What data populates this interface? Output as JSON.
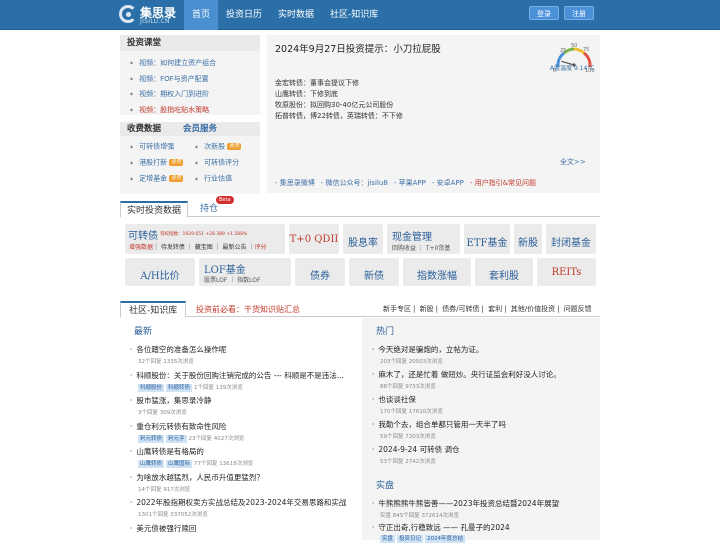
{
  "header": {
    "logo_name": "集思录",
    "logo_sub": "JISILU.CN",
    "nav": [
      "首页",
      "投资日历",
      "实时数据",
      "社区-知识库"
    ],
    "login": "登录",
    "register": "注册"
  },
  "course": {
    "title": "投资课堂",
    "items": [
      "视频：如何建立资产组合",
      "视频：FOF与资产配置",
      "视频：期权入门到进阶",
      "视频：股指吃贴水策略"
    ]
  },
  "data_service": {
    "tab1": "收费数据",
    "tab2": "会员服务",
    "items": [
      {
        "label": "可转债增强",
        "tag": ""
      },
      {
        "label": "次新股",
        "tag": "会员"
      },
      {
        "label": "港股打新",
        "tag": "会员"
      },
      {
        "label": "可转债评分",
        "tag": ""
      },
      {
        "label": "定增基金",
        "tag": "会员"
      },
      {
        "label": "行业估值",
        "tag": ""
      }
    ]
  },
  "tip": {
    "title": "2024年9月27日投资提示：小刀拉屁股",
    "lines": [
      "金宏转债：董事会提议下修",
      "山鹰转债：下修到底",
      "牧原股份：拟回购30-40亿元公司股份",
      "拓普转债，博22转债，英瑞转债：不下修"
    ],
    "more": "全文>>",
    "gauge_label": "A股温度 9.14°C",
    "gauge_ticks": [
      "0",
      "25",
      "50",
      "75",
      "100"
    ],
    "gauge_value": 9.14
  },
  "links": [
    "- 集思录微博",
    "- 微信公众号：jisilu8",
    "- 苹果APP",
    "- 安卓APP",
    "- 用户指引&常见问题"
  ],
  "realtime": {
    "tab": "实时投资数据",
    "hold": "持仓",
    "beta": "Beta",
    "kzz_title": "可转债",
    "kzz_index": "等权指数：1929.651 +28.389 +1.588%",
    "kzz_sub1": "增强数据",
    "kzz_sub_rest": "｜ 待发转债 ｜ 藏宝图 ｜ 最新公告 ｜",
    "kzz_sub_last": "评分",
    "tiles": [
      {
        "title": "T+0 QDII",
        "sub": ""
      },
      {
        "title": "股息率",
        "sub": ""
      },
      {
        "title": "现金管理",
        "sub": "回购收益 ｜ T+0货基"
      },
      {
        "title": "ETF基金",
        "sub": ""
      },
      {
        "title": "新股",
        "sub": ""
      },
      {
        "title": "封闭基金",
        "sub": ""
      },
      {
        "title": "A/H比价",
        "sub": ""
      },
      {
        "title": "LOF基金",
        "sub": "股票LOF ｜ 指数LOF"
      },
      {
        "title": "债券",
        "sub": ""
      },
      {
        "title": "新债",
        "sub": ""
      },
      {
        "title": "指数涨幅",
        "sub": ""
      },
      {
        "title": "套利股",
        "sub": ""
      },
      {
        "title": "REITs",
        "sub": ""
      }
    ]
  },
  "community": {
    "tab": "社区-知识库",
    "note": "投资前必看：干货知识贴汇总",
    "nav": [
      "新手专区",
      "新股",
      "债券/可转债",
      "套利",
      "其他/价值投资",
      "问题反馈"
    ],
    "latest_title": "最新",
    "latest": [
      {
        "title": "各位踏空的准备怎么操作呢",
        "tags": [],
        "meta": "32个回复 1335次浏览"
      },
      {
        "title": "科顺股份：关于股份回购注销完成的公告 --- 科顺是不是违法...",
        "tags": [
          "科顺股份",
          "科顺转债"
        ],
        "meta": "1个回复 139次浏览"
      },
      {
        "title": "股市猛涨，集思录冷静",
        "tags": [],
        "meta": "3个回复 309次浏览"
      },
      {
        "title": "重仓利元转债有致命性风险",
        "tags": [
          "利元转债",
          "利元亨"
        ],
        "meta": "23个回复 4027次浏览"
      },
      {
        "title": "山鹰转债是有格局的",
        "tags": [
          "山鹰转债",
          "山鹰国际"
        ],
        "meta": "77个回复 13618次浏览"
      },
      {
        "title": "为啥放水越猛烈，人民币升值更猛烈？",
        "tags": [],
        "meta": "14个回复 917次浏览"
      },
      {
        "title": "2022年股指期权卖方实战总结及2023-2024年交易思路和实战",
        "tags": [],
        "meta": "1301个回复 337052次浏览"
      },
      {
        "title": "美元债被强行赎回",
        "tags": [],
        "meta": ""
      }
    ],
    "hot_title": "热门",
    "hot": [
      {
        "title": "今天绝对是骗炮的，立帖为证。",
        "tags": [],
        "meta": "203个回复 20503次浏览"
      },
      {
        "title": "麻木了，还是忙着 做短炒。央行证监会利好没人讨论。",
        "tags": [],
        "meta": "88个回复 9733次浏览"
      },
      {
        "title": "也谈谈社保",
        "tags": [],
        "meta": "170个回复 17610次浏览"
      },
      {
        "title": "我勒个去，组合单都只管用一天半了吗",
        "tags": [],
        "meta": "59个回复 7203次浏览"
      },
      {
        "title": "2024-9-24 可转债 调仓",
        "tags": [],
        "meta": "53个回复 2742次浏览"
      }
    ],
    "best_title": "实盘",
    "best": [
      {
        "title": "牛熊熊熊牛熊皆善——2023年投资总结暨2024年展望",
        "tags": [],
        "meta": "实盘 845个回复 372614次浏览"
      },
      {
        "title": "守正出奇,行稳致远 —— 孔曼子的2024",
        "tags": [
          "实盘",
          "投资日记",
          "2024年度总结"
        ],
        "meta": ""
      }
    ]
  }
}
